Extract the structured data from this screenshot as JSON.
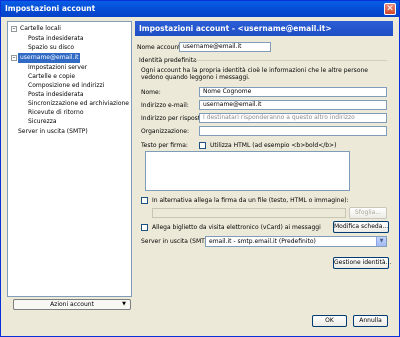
{
  "window": {
    "title": "Impostazioni account",
    "close_symbol": "✕"
  },
  "tree": {
    "local_folders": "Cartelle locali",
    "local_items": [
      "Posta indesiderata",
      "Spazio su disco"
    ],
    "account": "username@email.it",
    "account_items": [
      "Impostazioni server",
      "Cartelle e copie",
      "Composizione ed indirizzi",
      "Posta indesiderata",
      "Sincronizzazione ed archiviazione",
      "Ricevute di ritorno",
      "Sicurezza"
    ],
    "smtp": "Server in uscita (SMTP)",
    "collapse_symbol": "–"
  },
  "account_actions": {
    "label": "Azioni account",
    "arrow": "▼"
  },
  "panel": {
    "header": "Impostazioni account - <username@email.it>",
    "account_name_label": "Nome account:",
    "account_name_value": "username@email.it",
    "identity_group": "Identità predefinita",
    "identity_desc": "Ogni account ha la propria identità cioè le informazioni che le altre persone vedono quando leggono i messaggi.",
    "name_label": "Nome:",
    "name_value": "Nome Cognome",
    "email_label": "Indirizzo e-mail:",
    "email_value": "username@email.it",
    "replyto_label": "Indirizzo per risposte:",
    "replyto_placeholder": "I destinatari risponderanno a questo altro indirizzo",
    "org_label": "Organizzazione:",
    "org_value": "",
    "sig_label": "Testo per firma:",
    "html_label": "Utilizza HTML (ad esempio <b>bold</b>)",
    "attach_sig_label": "In alternativa allega la firma da un file (testo, HTML o immagine):",
    "browse_label": "Sfoglia...",
    "vcard_label": "Allega biglietto da visita elettronico (vCard) ai messaggi",
    "edit_card_label": "Modifica scheda...",
    "smtp_label": "Server in uscita (SMTP):",
    "smtp_value": "email.it - smtp.email.it (Predefinito)",
    "smtp_arrow": "▼",
    "manage_identities": "Gestione identità..."
  },
  "footer": {
    "ok": "OK",
    "cancel": "Annulla"
  }
}
